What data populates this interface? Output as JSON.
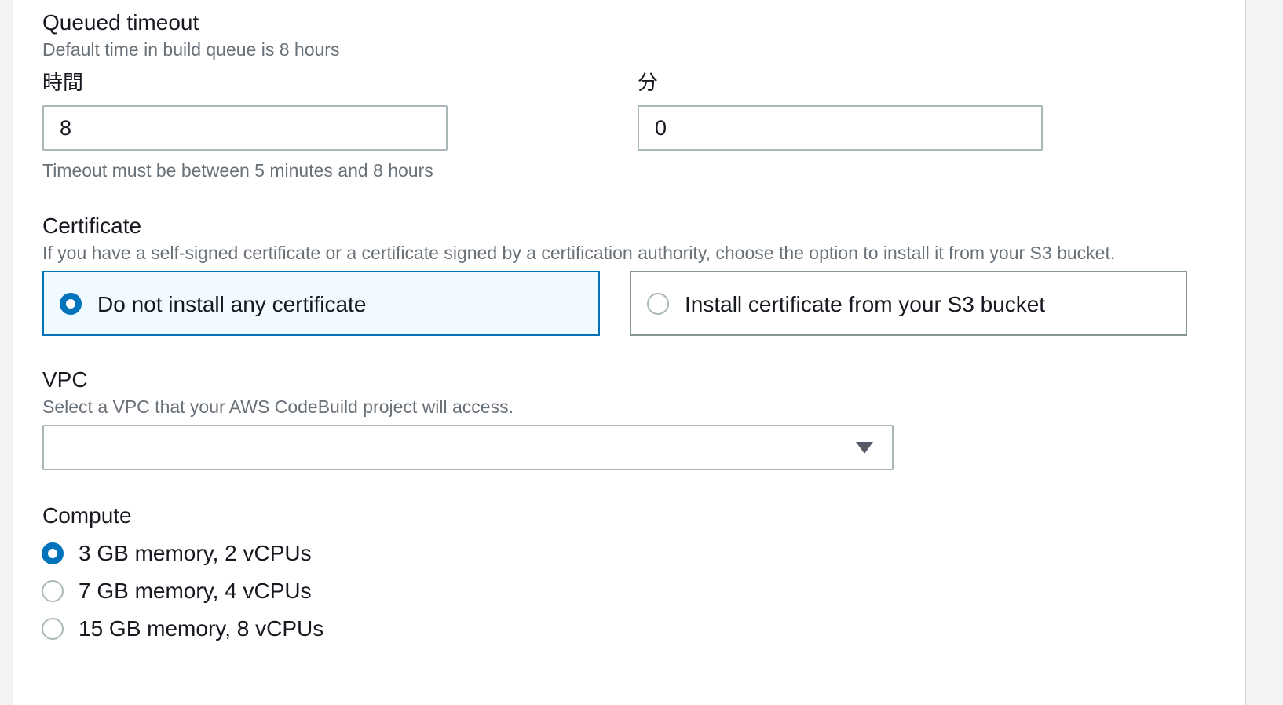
{
  "queued_timeout": {
    "label": "Queued timeout",
    "description": "Default time in build queue is 8 hours",
    "hours_label": "時間",
    "hours_value": "8",
    "minutes_label": "分",
    "minutes_value": "0",
    "constraint": "Timeout must be between 5 minutes and 8 hours"
  },
  "certificate": {
    "label": "Certificate",
    "description": "If you have a self-signed certificate or a certificate signed by a certification authority, choose the option to install it from your S3 bucket.",
    "options": [
      {
        "label": "Do not install any certificate",
        "selected": true
      },
      {
        "label": "Install certificate from your S3 bucket",
        "selected": false
      }
    ]
  },
  "vpc": {
    "label": "VPC",
    "description": "Select a VPC that your AWS CodeBuild project will access.",
    "selected_value": ""
  },
  "compute": {
    "label": "Compute",
    "options": [
      {
        "label": "3 GB memory, 2 vCPUs",
        "selected": true
      },
      {
        "label": "7 GB memory, 4 vCPUs",
        "selected": false
      },
      {
        "label": "15 GB memory, 8 vCPUs",
        "selected": false
      }
    ]
  },
  "colors": {
    "accent": "#0073bb",
    "selected_tile_bg": "#f1faff",
    "border": "#aab7b8",
    "description_text": "#687078"
  }
}
